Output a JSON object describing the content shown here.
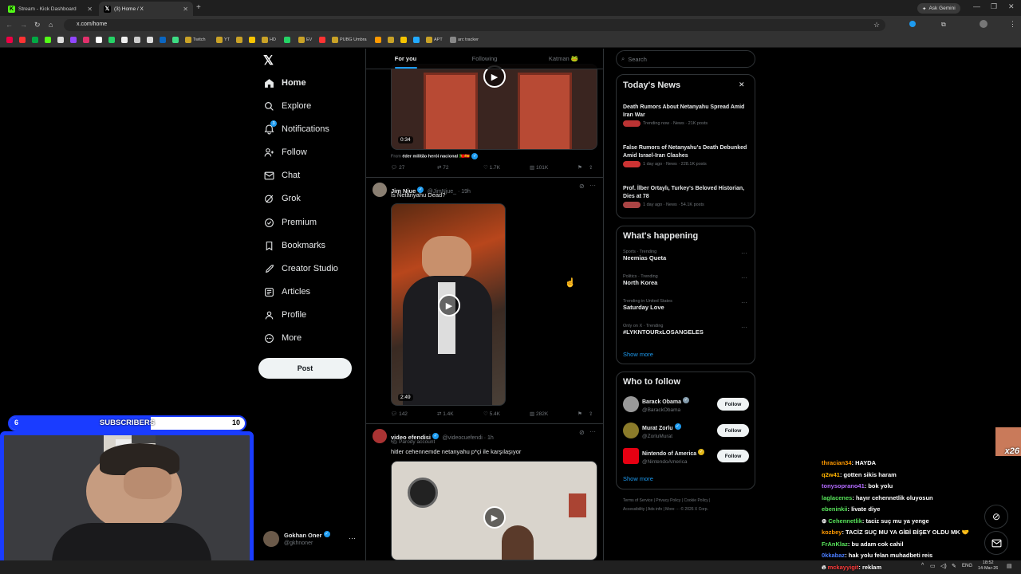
{
  "browser": {
    "tabs": [
      {
        "title": "Stream - Kick Dashboard",
        "icon": "kick-icon"
      },
      {
        "title": "(3) Home / X",
        "icon": "x-icon"
      }
    ],
    "url": "x.com/home",
    "ask_gemini": "Ask Gemini",
    "bookmarks": [
      "Twitch",
      "YT",
      "HD",
      "EV",
      "PUBG Umbra",
      "APT",
      "arc tracker"
    ]
  },
  "nav": {
    "items": [
      {
        "label": "Home",
        "icon": "home-icon"
      },
      {
        "label": "Explore",
        "icon": "search-icon"
      },
      {
        "label": "Notifications",
        "icon": "bell-icon"
      },
      {
        "label": "Follow",
        "icon": "follow-icon"
      },
      {
        "label": "Chat",
        "icon": "mail-icon"
      },
      {
        "label": "Grok",
        "icon": "grok-icon"
      },
      {
        "label": "Premium",
        "icon": "premium-icon"
      },
      {
        "label": "Bookmarks",
        "icon": "bookmark-icon"
      },
      {
        "label": "Creator Studio",
        "icon": "rocket-icon"
      },
      {
        "label": "Articles",
        "icon": "article-icon"
      },
      {
        "label": "Profile",
        "icon": "person-icon"
      },
      {
        "label": "More",
        "icon": "more-icon"
      }
    ],
    "notification_count": "3",
    "post_label": "Post",
    "user": {
      "name": "Gokhan Oner",
      "handle": "@gkhnoner"
    }
  },
  "feed": {
    "tabs": [
      "For you",
      "Following",
      "Katman 🐸"
    ],
    "post1": {
      "duration": "0:34",
      "from_label": "From",
      "from_name": "éder militão herói nacional 🇵🇹🇪🇸",
      "replies": "27",
      "reposts": "72",
      "likes": "1.7K",
      "views": "101K"
    },
    "post2": {
      "name": "Jim Njue",
      "handle": "@JimNjue_ · 19h",
      "text": "Is Netanyahu Dead?",
      "duration": "2:49",
      "replies": "142",
      "reposts": "1.4K",
      "likes": "5.4K",
      "views": "282K"
    },
    "post3": {
      "name": "video efendisi",
      "handle": "@videocuefendi · 1h",
      "sub": "Parody account",
      "text": "hitler cehennemde netanyahu p*çi ile karşılaşıyor"
    }
  },
  "right": {
    "search_placeholder": "Search",
    "news_title": "Today's News",
    "news": [
      {
        "title": "Death Rumors About Netanyahu Spread Amid Iran War",
        "meta": "Trending now · News · 21K posts"
      },
      {
        "title": "False Rumors of Netanyahu's Death Debunked Amid Israel-Iran Clashes",
        "meta": "1 day ago · News · 228.1K posts"
      },
      {
        "title": "Prof. İlber Ortaylı, Turkey's Beloved Historian, Dies at 78",
        "meta": "1 day ago · News · 54.1K posts"
      }
    ],
    "happening_title": "What's happening",
    "trends": [
      {
        "meta": "Sports · Trending",
        "title": "Neemias Queta"
      },
      {
        "meta": "Politics · Trending",
        "title": "North Korea"
      },
      {
        "meta": "Trending in United States",
        "title": "Saturday Love"
      },
      {
        "meta": "Only on X · Trending",
        "title": "#LYKNTOURxLOSANGELES"
      }
    ],
    "show_more": "Show more",
    "wtf_title": "Who to follow",
    "follows": [
      {
        "name": "Barack Obama",
        "handle": "@BarackObama"
      },
      {
        "name": "Murat Zorlu",
        "handle": "@ZorluMurat"
      },
      {
        "name": "Nintendo of America",
        "handle": "@NintendoAmerica"
      }
    ],
    "follow_label": "Follow",
    "footer1": "Terms of Service   |   Privacy Policy   |   Cookie Policy   |",
    "footer2": "Accessibility   |   Ads info   |   More ···   © 2026 X Corp."
  },
  "stream": {
    "sub_left": "6",
    "sub_label": "SUBSCRIBERS",
    "sub_right": "10",
    "sub_progress": 0.6,
    "badge": "x26",
    "chat": [
      {
        "user": "thracian34",
        "color": "#ff9900",
        "msg": ": HAYDA"
      },
      {
        "user": "q2w41",
        "color": "#ffb300",
        "msg": ": gotten sikis haram"
      },
      {
        "user": "tonysoprano41",
        "color": "#b36bff",
        "msg": ": bok yolu"
      },
      {
        "user": "laglacenes",
        "color": "#57e35a",
        "msg": ": hayır cehennetlik oluyosun"
      },
      {
        "user": "ebeninkii",
        "color": "#57e35a",
        "msg": ": livate diye"
      },
      {
        "user": "Cehennetlik",
        "color": "#57e35a",
        "msg": ": taciz suç mu ya yenge"
      },
      {
        "user": "kozbey",
        "color": "#ff9900",
        "msg": ": TACİZ SUÇ MU YA GİBİ BİŞEY OLDU MK 🤝"
      },
      {
        "user": "FrAnKlaz",
        "color": "#57e35a",
        "msg": ": bu adam cok cahil"
      },
      {
        "user": "0kkabaz",
        "color": "#4a7dff",
        "msg": ": hak yolu felan muhadbeti reis"
      },
      {
        "user": "mckayyigit",
        "color": "#ff3b3b",
        "msg": ": reklam"
      }
    ]
  },
  "taskbar": {
    "lang": "ENG",
    "time": "18:52",
    "date": "14-Mar-26"
  }
}
